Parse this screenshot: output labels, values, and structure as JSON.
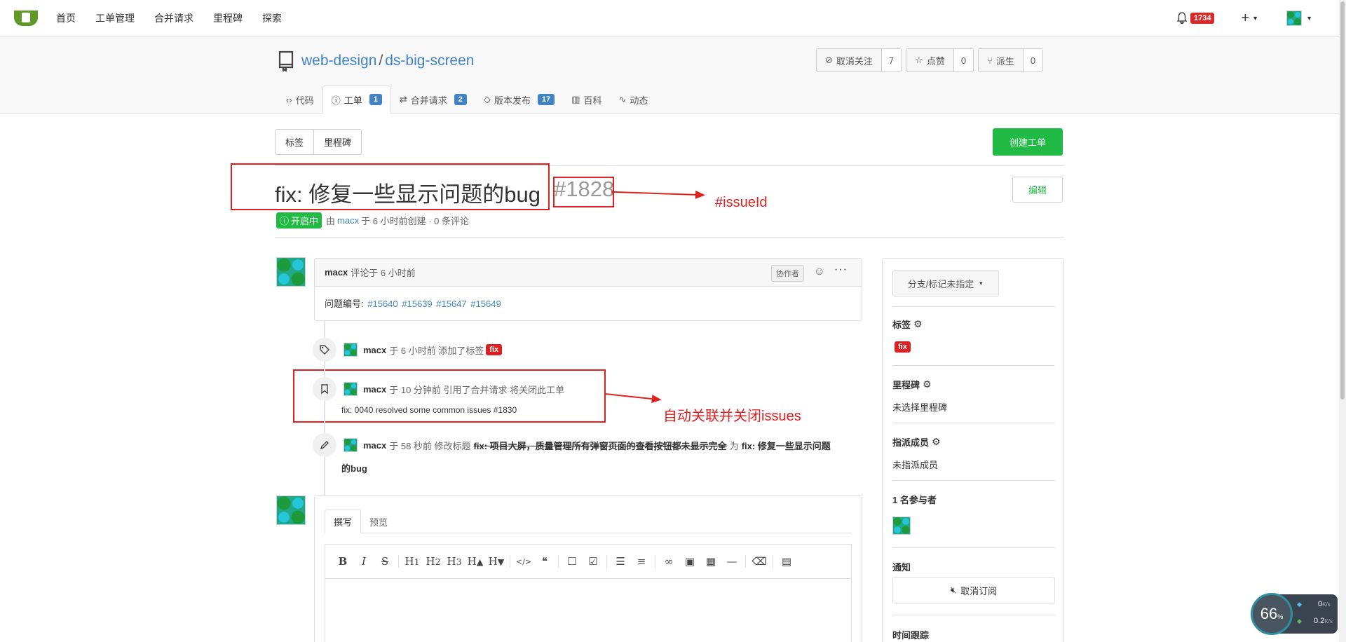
{
  "nav": {
    "items": [
      "首页",
      "工单管理",
      "合并请求",
      "里程碑",
      "探索"
    ],
    "notification_count": "1734"
  },
  "repo": {
    "owner": "web-design",
    "name": "ds-big-screen",
    "unwatch_label": "取消关注",
    "watch_count": "7",
    "star_label": "点赞",
    "star_count": "0",
    "fork_label": "派生",
    "fork_count": "0",
    "tabs": [
      {
        "label": "代码",
        "badge": ""
      },
      {
        "label": "工单",
        "badge": "1"
      },
      {
        "label": "合并请求",
        "badge": "2"
      },
      {
        "label": "版本发布",
        "badge": "17"
      },
      {
        "label": "百科",
        "badge": ""
      },
      {
        "label": "动态",
        "badge": ""
      }
    ]
  },
  "filter": {
    "labels_label": "标签",
    "milestones_label": "里程碑",
    "create_label": "创建工单"
  },
  "issue": {
    "title": "fix: 修复一些显示问题的bug",
    "number": "#1828",
    "edit_label": "编辑",
    "state": "开启中",
    "meta_prefix": "由",
    "author": "macx",
    "meta_suffix": "于 6 小时前创建 · 0 条评论"
  },
  "annotations": {
    "issue_id": "#issueId",
    "auto_close": "自动关联并关闭issues"
  },
  "comment": {
    "author": "macx",
    "time": "评论于 6 小时前",
    "role": "协作者",
    "body_prefix": "问题编号:",
    "refs": [
      "#15640",
      "#15639",
      "#15647",
      "#15649"
    ]
  },
  "timeline": [
    {
      "user": "macx",
      "text": "于 6 小时前 添加了标签",
      "label": "fix"
    },
    {
      "user": "macx",
      "text": "于 10 分钟前 引用了合并请求 将关闭此工单",
      "sub": "fix: 0040 resolved some common issues #1830"
    },
    {
      "user": "macx",
      "text": "于 58 秒前 修改标题",
      "old": "fix: 项目大屏，质量管理所有弹窗页面的查看按钮都未显示完全",
      "mid": "为",
      "new1": "fix: 修复一些显示问题",
      "new2": "的bug"
    }
  ],
  "editor": {
    "write_tab": "撰写",
    "preview_tab": "预览",
    "toolbar": [
      "B",
      "I",
      "S",
      "H1",
      "H2",
      "H3",
      "H▲",
      "H▼",
      "</>",
      "❝",
      "☐",
      "☑",
      "list-ul",
      "list-ol",
      "link",
      "image",
      "table",
      "hr",
      "eraser",
      "file"
    ]
  },
  "sidebar": {
    "branch_label": "分支/标记未指定",
    "labels_title": "标签",
    "label_value": "fix",
    "milestone_title": "里程碑",
    "milestone_value": "未选择里程碑",
    "assignees_title": "指派成员",
    "assignees_value": "未指派成员",
    "participants_title": "1 名参与者",
    "notify_title": "通知",
    "unsubscribe_label": "取消订阅",
    "time_title": "时间跟踪"
  },
  "speed_widget": {
    "percent": "66",
    "unit": "%",
    "up": "0",
    "up_unit": "K/s",
    "down": "0.2",
    "down_unit": "K/s"
  },
  "colors": {
    "green": "#21ba45",
    "blue": "#4183c4",
    "red": "#e02020"
  }
}
